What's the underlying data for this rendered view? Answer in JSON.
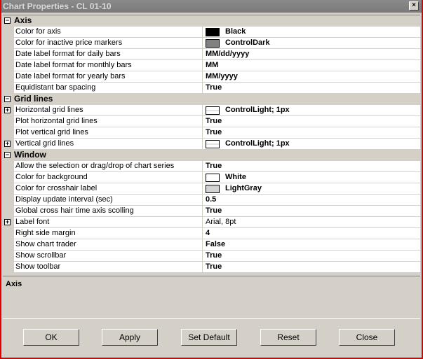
{
  "window": {
    "title": "Chart Properties - CL 01-10",
    "close": "×"
  },
  "categories": [
    {
      "label": "Axis",
      "rows": [
        {
          "name": "Color for axis",
          "value": "Black",
          "swatch": "#000000"
        },
        {
          "name": "Color for inactive price markers",
          "value": "ControlDark",
          "swatch": "#808080"
        },
        {
          "name": "Date label format for daily bars",
          "value": "MM/dd/yyyy"
        },
        {
          "name": "Date label format for monthly bars",
          "value": "MM"
        },
        {
          "name": "Date label format for yearly bars",
          "value": "MM/yyyy"
        },
        {
          "name": "Equidistant bar spacing",
          "value": "True"
        }
      ]
    },
    {
      "label": "Grid lines",
      "rows": [
        {
          "name": "Horizontal grid lines",
          "value": "ControlLight; 1px",
          "swatch": "#ffffff",
          "line": true,
          "expand": true
        },
        {
          "name": "Plot horizontal grid lines",
          "value": "True"
        },
        {
          "name": "Plot vertical grid lines",
          "value": "True"
        },
        {
          "name": "Vertical grid lines",
          "value": "ControlLight; 1px",
          "swatch": "#ffffff",
          "line": true,
          "expand": true
        }
      ]
    },
    {
      "label": "Window",
      "rows": [
        {
          "name": "Allow the selection or drag/drop of chart series",
          "value": "True"
        },
        {
          "name": "Color for background",
          "value": "White",
          "swatch": "#ffffff"
        },
        {
          "name": "Color for crosshair label",
          "value": "LightGray",
          "swatch": "#d3d3d3"
        },
        {
          "name": "Display update interval (sec)",
          "value": "0.5"
        },
        {
          "name": "Global cross hair time axis scolling",
          "value": "True"
        },
        {
          "name": "Label font",
          "value": "Arial, 8pt",
          "plain": true,
          "expand": true
        },
        {
          "name": "Right side margin",
          "value": "4"
        },
        {
          "name": "Show chart trader",
          "value": "False"
        },
        {
          "name": "Show scrollbar",
          "value": "True"
        },
        {
          "name": "Show toolbar",
          "value": "True"
        }
      ]
    }
  ],
  "description": {
    "title": "Axis"
  },
  "buttons": {
    "ok": "OK",
    "apply": "Apply",
    "set_default": "Set Default",
    "reset": "Reset",
    "close": "Close"
  }
}
